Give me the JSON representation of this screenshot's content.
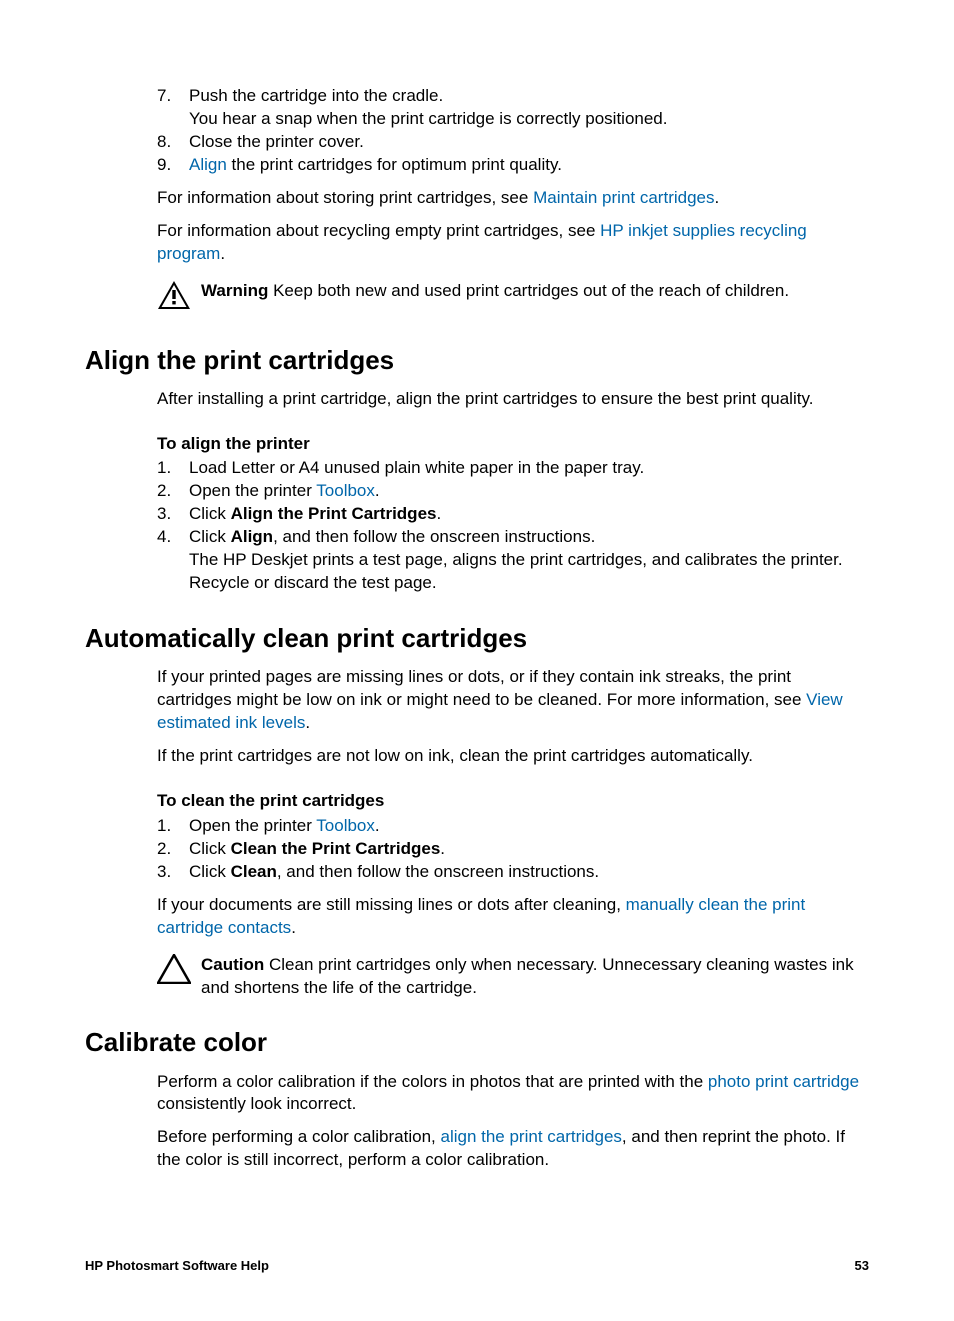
{
  "list1": {
    "7": {
      "num": "7.",
      "text1": "Push the cartridge into the cradle.",
      "text2": "You hear a snap when the print cartridge is correctly positioned."
    },
    "8": {
      "num": "8.",
      "text": "Close the printer cover."
    },
    "9": {
      "num": "9.",
      "link": "Align",
      "text": " the print cartridges for optimum print quality."
    }
  },
  "para1": {
    "pre": "For information about storing print cartridges, see ",
    "link": "Maintain print cartridges",
    "post": "."
  },
  "para2": {
    "pre": "For information about recycling empty print cartridges, see ",
    "link": "HP inkjet supplies recycling program",
    "post": "."
  },
  "warning": {
    "label": "Warning",
    "text": "   Keep both new and used print cartridges out of the reach of children."
  },
  "h2a": "Align the print cartridges",
  "para3": "After installing a print cartridge, align the print cartridges to ensure the best print quality.",
  "sub1": "To align the printer",
  "list2": {
    "1": {
      "num": "1.",
      "text": "Load Letter or A4 unused plain white paper in the paper tray."
    },
    "2": {
      "num": "2.",
      "pre": "Open the printer ",
      "link": "Toolbox",
      "post": "."
    },
    "3": {
      "num": "3.",
      "pre": "Click ",
      "bold": "Align the Print Cartridges",
      "post": "."
    },
    "4": {
      "num": "4.",
      "pre": "Click ",
      "bold": "Align",
      "post": ", and then follow the onscreen instructions.",
      "text2": "The HP Deskjet prints a test page, aligns the print cartridges, and calibrates the printer. Recycle or discard the test page."
    }
  },
  "h2b": "Automatically clean print cartridges",
  "para4": {
    "text1": "If your printed pages are missing lines or dots, or if they contain ink streaks, the print cartridges might be low on ink or might need to be cleaned. For more information, see ",
    "link": "View estimated ink levels",
    "post": "."
  },
  "para5": "If the print cartridges are not low on ink, clean the print cartridges automatically.",
  "sub2": "To clean the print cartridges",
  "list3": {
    "1": {
      "num": "1.",
      "pre": "Open the printer ",
      "link": "Toolbox",
      "post": "."
    },
    "2": {
      "num": "2.",
      "pre": "Click ",
      "bold": "Clean the Print Cartridges",
      "post": "."
    },
    "3": {
      "num": "3.",
      "pre": "Click ",
      "bold": "Clean",
      "post": ", and then follow the onscreen instructions."
    }
  },
  "para6": {
    "pre": "If your documents are still missing lines or dots after cleaning, ",
    "link": "manually clean the print cartridge contacts",
    "post": "."
  },
  "caution": {
    "label": "Caution",
    "text": "   Clean print cartridges only when necessary. Unnecessary cleaning wastes ink and shortens the life of the cartridge."
  },
  "h2c": "Calibrate color",
  "para7": {
    "pre": "Perform a color calibration if the colors in photos that are printed with the ",
    "link": "photo print cartridge",
    "post": " consistently look incorrect."
  },
  "para8": {
    "pre": "Before performing a color calibration, ",
    "link": "align the print cartridges",
    "post": ", and then reprint the photo. If the color is still incorrect, perform a color calibration."
  },
  "footer": {
    "left": "HP Photosmart Software Help",
    "right": "53"
  }
}
